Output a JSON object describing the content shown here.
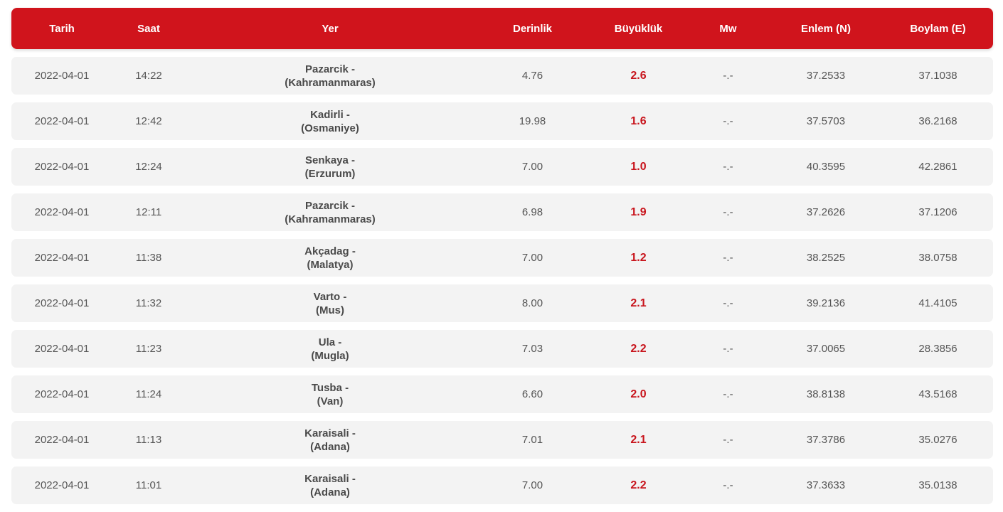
{
  "colors": {
    "header_bg": "#d0141c",
    "row_bg": "#f3f3f3",
    "magnitude": "#c8141c",
    "text": "#555555"
  },
  "columns": {
    "date": "Tarih",
    "time": "Saat",
    "place": "Yer",
    "depth": "Derinlik",
    "magnitude": "Büyüklük",
    "mw": "Mw",
    "lat": "Enlem (N)",
    "lon": "Boylam (E)"
  },
  "rows": [
    {
      "date": "2022-04-01",
      "time": "14:22",
      "place_line1": "Pazarcik -",
      "place_line2": "(Kahramanmaras)",
      "depth": "4.76",
      "magnitude": "2.6",
      "mw": "-.-",
      "lat": "37.2533",
      "lon": "37.1038"
    },
    {
      "date": "2022-04-01",
      "time": "12:42",
      "place_line1": "Kadirli -",
      "place_line2": "(Osmaniye)",
      "depth": "19.98",
      "magnitude": "1.6",
      "mw": "-.-",
      "lat": "37.5703",
      "lon": "36.2168"
    },
    {
      "date": "2022-04-01",
      "time": "12:24",
      "place_line1": "Senkaya -",
      "place_line2": "(Erzurum)",
      "depth": "7.00",
      "magnitude": "1.0",
      "mw": "-.-",
      "lat": "40.3595",
      "lon": "42.2861"
    },
    {
      "date": "2022-04-01",
      "time": "12:11",
      "place_line1": "Pazarcik -",
      "place_line2": "(Kahramanmaras)",
      "depth": "6.98",
      "magnitude": "1.9",
      "mw": "-.-",
      "lat": "37.2626",
      "lon": "37.1206"
    },
    {
      "date": "2022-04-01",
      "time": "11:38",
      "place_line1": "Akçadag -",
      "place_line2": "(Malatya)",
      "depth": "7.00",
      "magnitude": "1.2",
      "mw": "-.-",
      "lat": "38.2525",
      "lon": "38.0758"
    },
    {
      "date": "2022-04-01",
      "time": "11:32",
      "place_line1": "Varto -",
      "place_line2": "(Mus)",
      "depth": "8.00",
      "magnitude": "2.1",
      "mw": "-.-",
      "lat": "39.2136",
      "lon": "41.4105"
    },
    {
      "date": "2022-04-01",
      "time": "11:23",
      "place_line1": "Ula -",
      "place_line2": "(Mugla)",
      "depth": "7.03",
      "magnitude": "2.2",
      "mw": "-.-",
      "lat": "37.0065",
      "lon": "28.3856"
    },
    {
      "date": "2022-04-01",
      "time": "11:24",
      "place_line1": "Tusba -",
      "place_line2": "(Van)",
      "depth": "6.60",
      "magnitude": "2.0",
      "mw": "-.-",
      "lat": "38.8138",
      "lon": "43.5168"
    },
    {
      "date": "2022-04-01",
      "time": "11:13",
      "place_line1": "Karaisali -",
      "place_line2": "(Adana)",
      "depth": "7.01",
      "magnitude": "2.1",
      "mw": "-.-",
      "lat": "37.3786",
      "lon": "35.0276"
    },
    {
      "date": "2022-04-01",
      "time": "11:01",
      "place_line1": "Karaisali -",
      "place_line2": "(Adana)",
      "depth": "7.00",
      "magnitude": "2.2",
      "mw": "-.-",
      "lat": "37.3633",
      "lon": "35.0138"
    }
  ]
}
